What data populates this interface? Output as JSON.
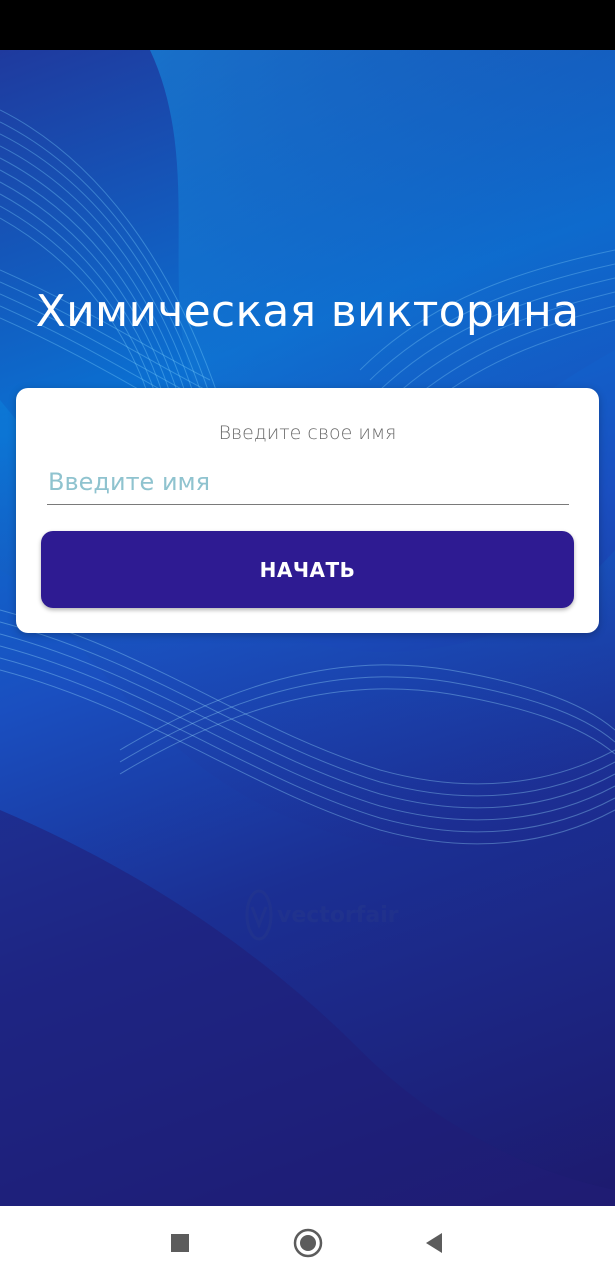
{
  "app": {
    "title": "Химическая викторина"
  },
  "card": {
    "label": "Введите свое имя",
    "name_input": {
      "value": "",
      "placeholder": "Введите имя"
    },
    "start_button_label": "НАЧАТЬ"
  },
  "watermark": {
    "text": "vectorfair"
  },
  "nav_bar": {
    "icons": [
      "recents-square-icon",
      "home-circle-icon",
      "back-triangle-icon"
    ]
  },
  "colors": {
    "button": "#2e1b92",
    "placeholder": "#8fc3cf",
    "background_primary": "#0b6fd1",
    "background_dark": "#1d1a6e"
  }
}
